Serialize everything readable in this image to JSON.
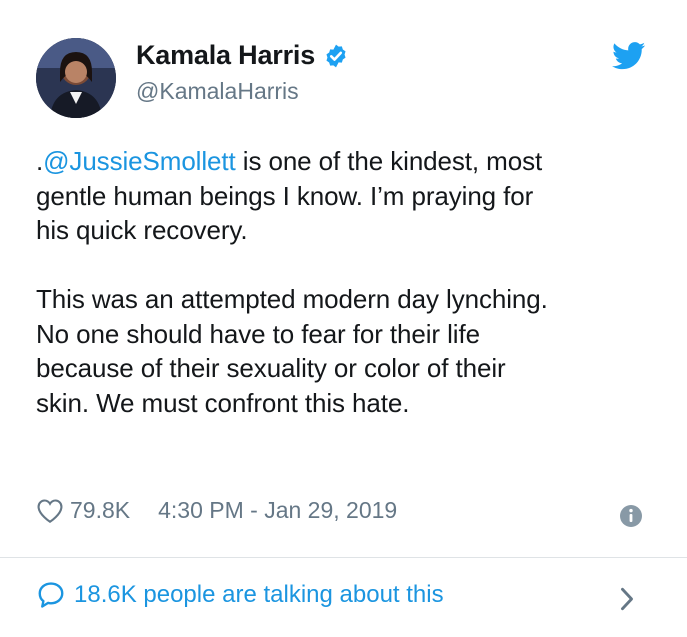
{
  "author": {
    "display_name": "Kamala Harris",
    "handle": "@KamalaHarris",
    "verified": true
  },
  "tweet": {
    "prefix": ".",
    "mention": "@JussieSmollett",
    "line1_rest": " is one of the kindest, most\ngentle human beings I know. I’m praying for\nhis quick recovery.\n\nThis was an attempted modern day lynching.\nNo one should have to fear for their life\nbecause of their sexuality or color of their\nskin. We must confront this hate."
  },
  "meta": {
    "likes": "79.8K",
    "timestamp": "4:30 PM - Jan 29, 2019"
  },
  "footer": {
    "talking_label": "18.6K people are talking about this"
  },
  "icons": {
    "brand": "twitter-bird-icon",
    "verified": "verified-badge-icon",
    "like": "heart-icon",
    "info": "info-icon",
    "reply": "speech-bubble-icon",
    "more": "chevron-right-icon"
  },
  "colors": {
    "brand_blue": "#1da1f2",
    "link_blue": "#1b95e0",
    "text": "#14171a",
    "secondary": "#657786"
  }
}
